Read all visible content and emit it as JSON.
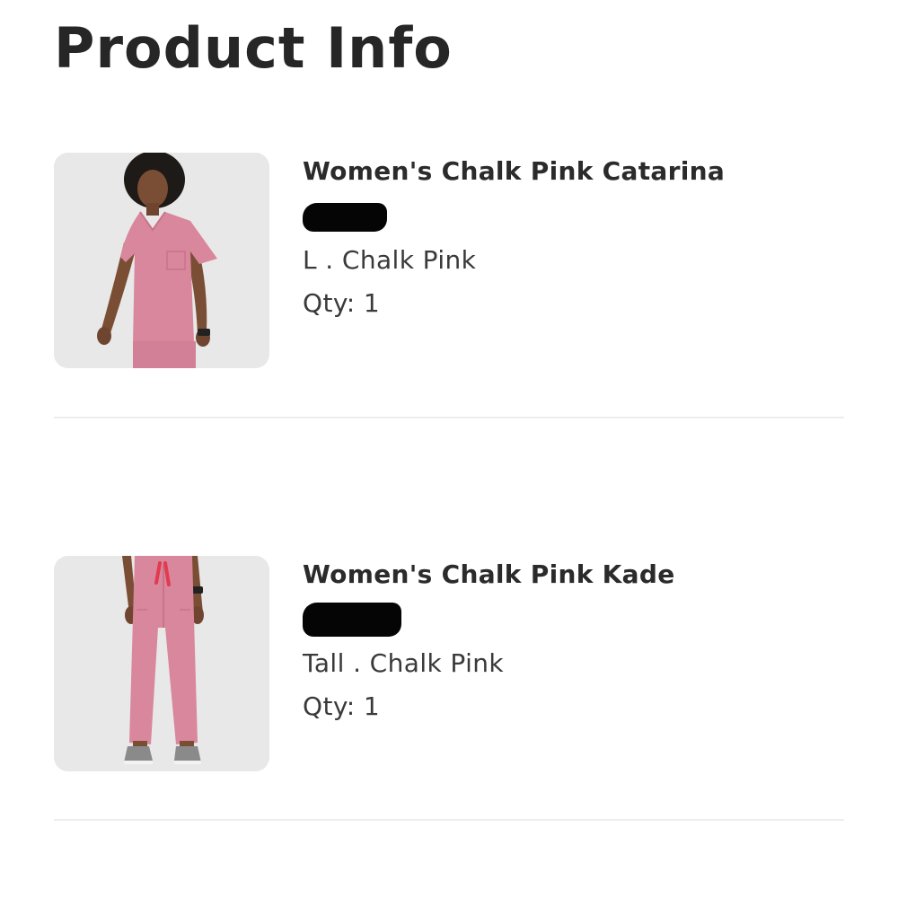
{
  "page": {
    "title": "Product Info"
  },
  "items": [
    {
      "name": "Women's Chalk Pink Catarina",
      "variant": "L . Chalk Pink",
      "qty": "Qty: 1",
      "image_icon": "scrub-top-photo"
    },
    {
      "name": "Women's Chalk Pink Kade",
      "variant": "Tall . Chalk Pink",
      "qty": "Qty: 1",
      "image_icon": "scrub-pants-photo"
    }
  ],
  "colors": {
    "product_pink": "#d9879d",
    "text": "#2b2b2b",
    "divider": "#ededed",
    "thumb_bg": "#e9e9e9"
  }
}
